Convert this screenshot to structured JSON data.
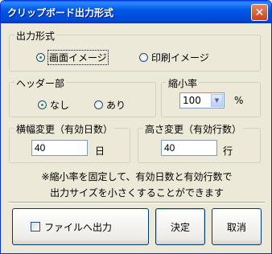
{
  "window": {
    "title": "クリップボード出力形式"
  },
  "output_format": {
    "legend": "出力形式",
    "options": [
      {
        "label": "画面イメージ",
        "checked": true
      },
      {
        "label": "印刷イメージ",
        "checked": false
      }
    ]
  },
  "header_section": {
    "legend": "ヘッダー部",
    "options": [
      {
        "label": "なし",
        "checked": true
      },
      {
        "label": "あり",
        "checked": false
      }
    ]
  },
  "zoom": {
    "legend": "縮小率",
    "value": "100",
    "unit": "%"
  },
  "width_change": {
    "legend": "横幅変更（有効日数）",
    "value": "40",
    "unit": "日"
  },
  "height_change": {
    "legend": "高さ変更（有効行数）",
    "value": "40",
    "unit": "行"
  },
  "note": {
    "line1": "※縮小率を固定して、有効日数と有効行数で",
    "line2": "出力サイズを小さくすることができます"
  },
  "file_output": {
    "label": "ファイルへ出力",
    "checked": false
  },
  "buttons": {
    "ok": "決定",
    "cancel": "取消"
  }
}
